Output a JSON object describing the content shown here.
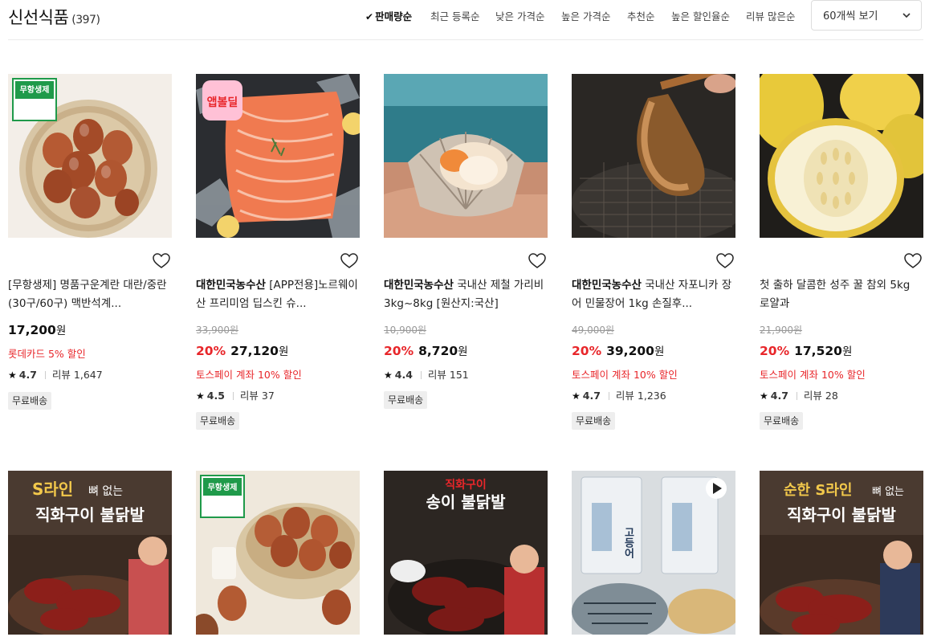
{
  "header": {
    "title": "신선식품",
    "count": "(397)",
    "sort_options": [
      {
        "label": "판매량순",
        "active": true
      },
      {
        "label": "최근 등록순",
        "active": false
      },
      {
        "label": "낮은 가격순",
        "active": false
      },
      {
        "label": "높은 가격순",
        "active": false
      },
      {
        "label": "추천순",
        "active": false
      },
      {
        "label": "높은 할인율순",
        "active": false
      },
      {
        "label": "리뷰 많은순",
        "active": false
      }
    ],
    "page_size": "60개씩 보기"
  },
  "products": [
    {
      "brand": "",
      "name": "[무항생제] 명품구운계란 대란/중란 (30구/60구) 맥반석계...",
      "original_price": "",
      "discount": "",
      "price": "17,200",
      "won": "원",
      "promo": "롯데카드 5% 할인",
      "rating": "4.7",
      "reviews": "리뷰 1,647",
      "badge": "무료배송",
      "image": "eggs-basket",
      "sticker": "무항생제"
    },
    {
      "brand": "대한민국농수산",
      "name": "[APP전용]노르웨이산 프리미엄 딥스킨 슈...",
      "original_price": "33,900원",
      "discount": "20%",
      "price": "27,120",
      "won": "원",
      "promo": "토스페이 계좌 10% 할인",
      "rating": "4.5",
      "reviews": "리뷰 37",
      "badge": "무료배송",
      "image": "salmon",
      "sticker": "앱볼딜"
    },
    {
      "brand": "대한민국농수산",
      "name": "국내산 제철 가리비 3kg~8kg [원산지:국산]",
      "original_price": "10,900원",
      "discount": "20%",
      "price": "8,720",
      "won": "원",
      "promo": "",
      "rating": "4.4",
      "reviews": "리뷰 151",
      "badge": "무료배송",
      "image": "scallop",
      "sticker": ""
    },
    {
      "brand": "대한민국농수산",
      "name": "국내산 자포니카 장어 민물장어 1kg 손질후...",
      "original_price": "49,000원",
      "discount": "20%",
      "price": "39,200",
      "won": "원",
      "promo": "토스페이 계좌 10% 할인",
      "rating": "4.7",
      "reviews": "리뷰 1,236",
      "badge": "무료배송",
      "image": "eel",
      "sticker": ""
    },
    {
      "brand": "",
      "name": "첫 출하 달콤한 성주 꿀 참외 5kg 로얄과",
      "original_price": "21,900원",
      "discount": "20%",
      "price": "17,520",
      "won": "원",
      "promo": "토스페이 계좌 10% 할인",
      "rating": "4.7",
      "reviews": "리뷰 28",
      "badge": "무료배송",
      "image": "melon",
      "sticker": ""
    }
  ],
  "row2": [
    {
      "image": "chicken-feet",
      "headline_1": "S라인",
      "headline_2": "뼈 없는",
      "headline_3": "직화구이 불닭발",
      "sticker": ""
    },
    {
      "image": "eggs-bowl",
      "headline_1": "",
      "headline_2": "",
      "headline_3": "",
      "sticker": "무항생제"
    },
    {
      "image": "chicken-feet-2",
      "headline_1": "직화구이",
      "headline_2": "",
      "headline_3": "송이 불닭발",
      "sticker": ""
    },
    {
      "image": "mackerel",
      "headline_1": "고등어",
      "headline_2": "",
      "headline_3": "",
      "sticker": "video"
    },
    {
      "image": "chicken-feet-3",
      "headline_1": "순한 S라인",
      "headline_2": "뼈 없는",
      "headline_3": "직화구이 불닭발",
      "sticker": ""
    }
  ],
  "colors": {
    "accent_red": "#e8262a",
    "badge_bg": "#eeeeee",
    "text": "#222222"
  }
}
